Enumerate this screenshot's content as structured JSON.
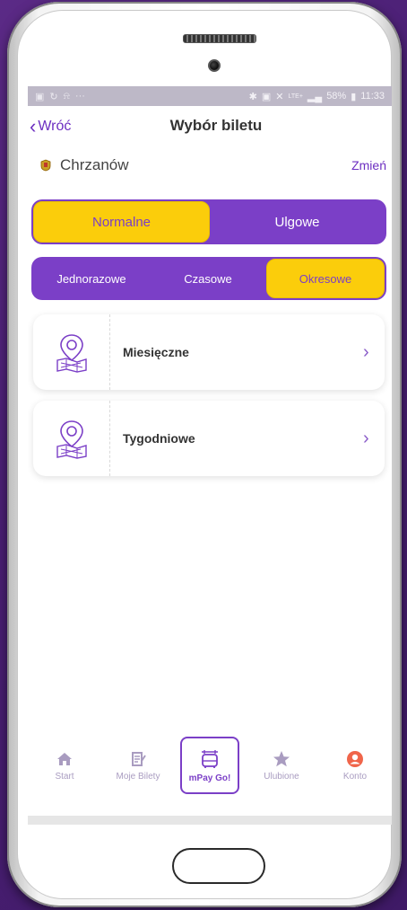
{
  "statusbar": {
    "battery": "58%",
    "time": "11:33",
    "network": "LTE+"
  },
  "header": {
    "back_label": "Wróć",
    "title": "Wybór biletu"
  },
  "city": {
    "name": "Chrzanów",
    "change_label": "Zmień"
  },
  "ticket_type": {
    "options": [
      "Normalne",
      "Ulgowe"
    ],
    "selected": "Normalne"
  },
  "ticket_period": {
    "options": [
      "Jednorazowe",
      "Czasowe",
      "Okresowe"
    ],
    "selected": "Okresowe"
  },
  "tickets": [
    {
      "label": "Miesięczne",
      "icon": "map-pin-icon"
    },
    {
      "label": "Tygodniowe",
      "icon": "map-pin-icon"
    }
  ],
  "nav": [
    {
      "label": "Start",
      "icon": "home-icon"
    },
    {
      "label": "Moje Bilety",
      "icon": "tickets-icon"
    },
    {
      "label": "mPay Go!",
      "icon": "bus-icon"
    },
    {
      "label": "Ulubione",
      "icon": "star-icon"
    },
    {
      "label": "Konto",
      "icon": "account-icon"
    }
  ],
  "colors": {
    "accent": "#7b3fc7",
    "highlight": "#fbcd0b",
    "account": "#f0654a",
    "background": "#4a1f74"
  }
}
